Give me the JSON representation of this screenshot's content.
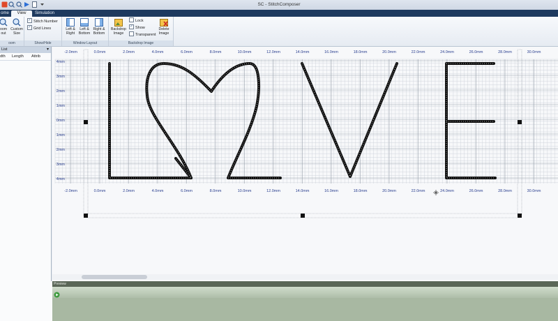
{
  "window": {
    "title": "SC - StitchComposer"
  },
  "tabs": [
    {
      "label": "ome",
      "active": false
    },
    {
      "label": "View",
      "active": true
    },
    {
      "label": "Simulation",
      "active": false
    }
  ],
  "ribbon": {
    "zoom": {
      "zoom_out": "oom\nout",
      "custom_size": "Custom\nSize",
      "group": "oom"
    },
    "show_hide": {
      "stitch_number": "Stitch Number",
      "grid_lines": "Grid Lines",
      "group": "Show/Hide"
    },
    "window_layout": {
      "left_right": "Left &\nRight",
      "left_bottom": "Left &\nBottom",
      "right_bottom": "Right &\nBottom",
      "group": "Window Layout"
    },
    "backdrop": {
      "backdrop_image": "Backdrop\nImage",
      "lock": "Lock",
      "show": "Show",
      "transparent": "Transparent",
      "delete_image": "Delete\nImage",
      "group": "Backdrop Image"
    }
  },
  "left_panel": {
    "title": "List",
    "columns": [
      "dth",
      "Length",
      "Attrib"
    ]
  },
  "ruler": {
    "x_labels": [
      "-2.0mm",
      "0.0mm",
      "2.0mm",
      "4.0mm",
      "6.0mm",
      "8.0mm",
      "10.0mm",
      "12.0mm",
      "14.0mm",
      "16.0mm",
      "18.0mm",
      "20.0mm",
      "22.0mm",
      "24.0mm",
      "26.0mm",
      "28.0mm",
      "30.0mm"
    ],
    "y_labels": [
      "4mm",
      "3mm",
      "2mm",
      "1mm",
      "0mm",
      "1mm",
      "2mm",
      "3mm",
      "4mm"
    ]
  },
  "bottom_panel": {
    "title": "Preview"
  },
  "colors": {
    "ribbon_tab_bg": "#1e3a5f",
    "axis_label": "#2a3f8f",
    "stitch": "#111111",
    "preview_bg": "#a8b8a2"
  },
  "icons": [
    "zoom-out-icon",
    "custom-size-icon",
    "left-right-layout-icon",
    "left-bottom-layout-icon",
    "right-bottom-layout-icon",
    "backdrop-image-icon",
    "delete-image-icon",
    "play-icon"
  ]
}
